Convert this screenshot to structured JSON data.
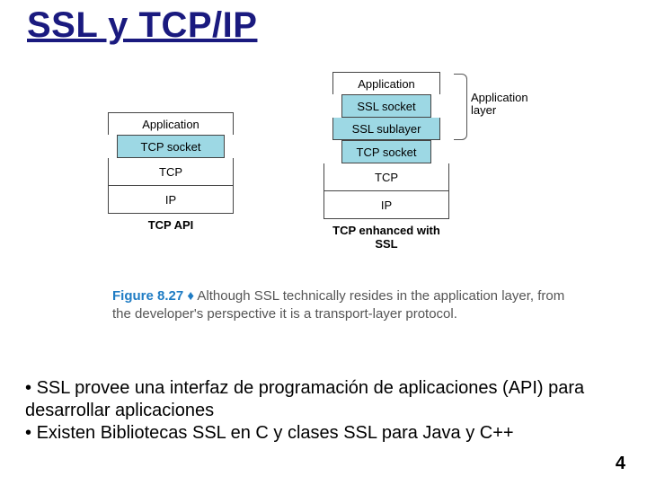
{
  "title": "SSL y TCP/IP",
  "diagram": {
    "left_stack": {
      "boxes": [
        "Application",
        "TCP socket",
        "TCP",
        "IP"
      ],
      "label": "TCP API"
    },
    "right_stack": {
      "boxes": [
        "Application",
        "SSL socket",
        "SSL sublayer",
        "TCP socket",
        "TCP",
        "IP"
      ],
      "label": "TCP enhanced with SSL"
    },
    "bracket_label": "Application layer"
  },
  "caption": {
    "figure_label": "Figure 8.27",
    "diamond": "♦",
    "text": "Although SSL technically resides in the application layer, from the developer's perspective it is a transport-layer protocol."
  },
  "bullets": {
    "b1_prefix": "• ",
    "b1": "SSL provee una interfaz de programación de aplicaciones (API) para desarrollar aplicaciones",
    "b2_prefix": "• ",
    "b2": "Existen Bibliotecas SSL en C y clases SSL para Java y C++"
  },
  "page_number": "4"
}
